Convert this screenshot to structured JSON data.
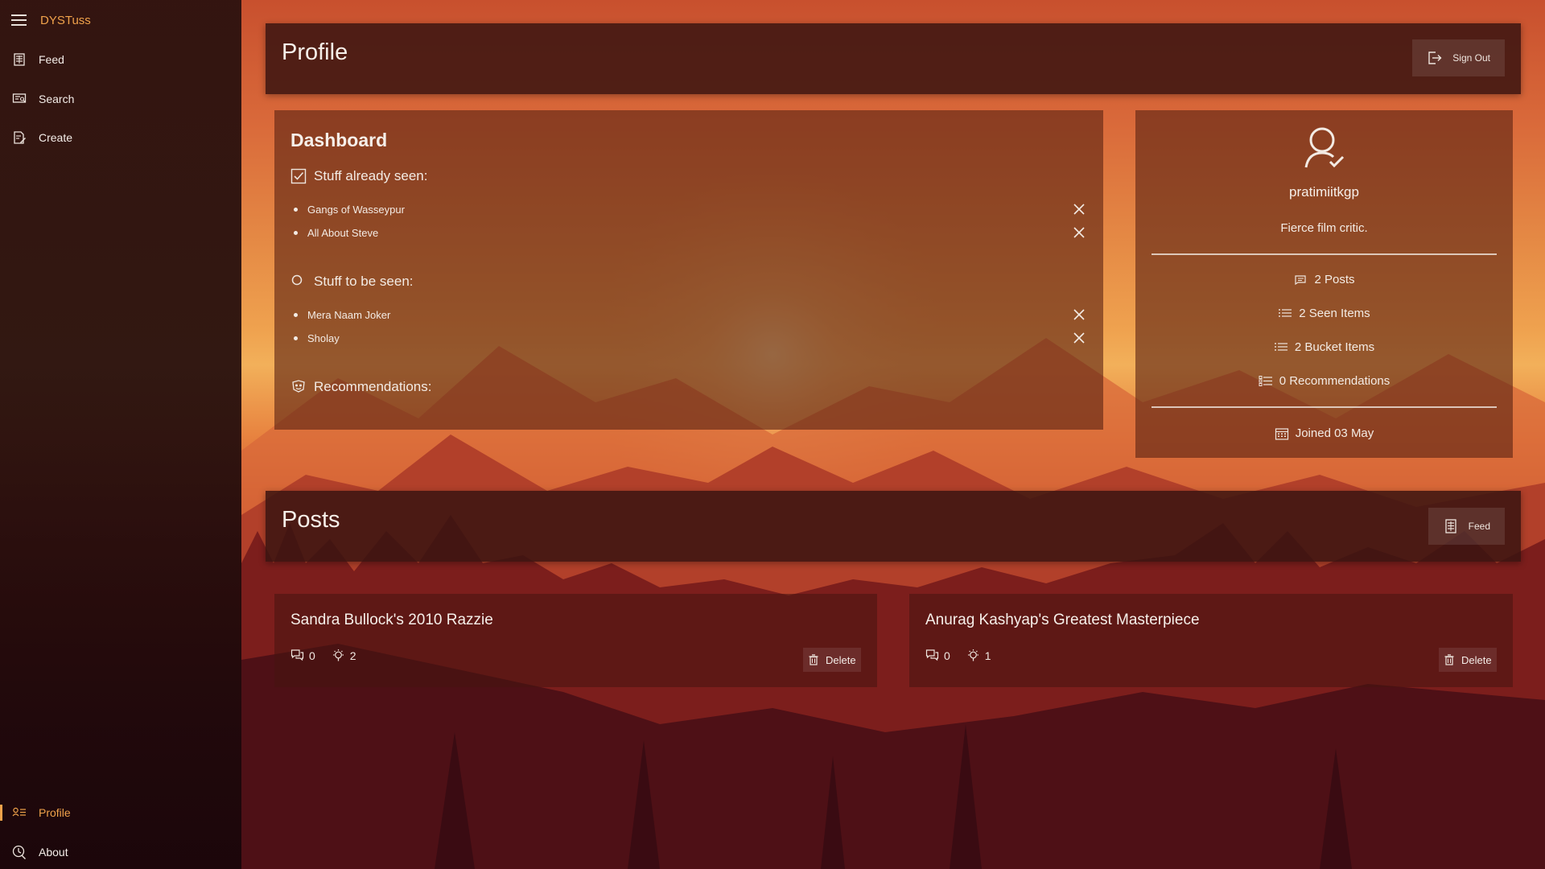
{
  "app": {
    "title": "DYSTuss"
  },
  "sidebar": {
    "items": [
      {
        "label": "Feed",
        "icon": "feed-icon"
      },
      {
        "label": "Search",
        "icon": "search-icon"
      },
      {
        "label": "Create",
        "icon": "create-icon"
      }
    ],
    "bottom_items": [
      {
        "label": "Profile",
        "icon": "profile-icon",
        "active": true
      },
      {
        "label": "About",
        "icon": "about-icon"
      }
    ],
    "accent_color": "#f0a24b"
  },
  "profile_header": {
    "title": "Profile",
    "sign_out_label": "Sign Out"
  },
  "dashboard": {
    "title": "Dashboard",
    "seen": {
      "label": "Stuff already seen:",
      "items": [
        "Gangs of Wasseypur",
        "All About Steve"
      ]
    },
    "to_see": {
      "label": "Stuff to be seen:",
      "items": [
        "Mera Naam Joker",
        "Sholay"
      ]
    },
    "recommendations": {
      "label": "Recommendations:"
    }
  },
  "user": {
    "username": "pratimiitkgp",
    "bio": "Fierce film critic.",
    "stats": {
      "posts": "2 Posts",
      "seen": "2 Seen Items",
      "bucket": "2 Bucket Items",
      "recommendations": "0 Recommendations"
    },
    "joined": "Joined 03 May"
  },
  "posts_header": {
    "title": "Posts",
    "feed_label": "Feed"
  },
  "posts": [
    {
      "title": "Sandra Bullock's 2010 Razzie",
      "comments": "0",
      "likes": "2",
      "delete_label": "Delete"
    },
    {
      "title": "Anurag Kashyap's Greatest Masterpiece",
      "comments": "0",
      "likes": "1",
      "delete_label": "Delete"
    }
  ]
}
